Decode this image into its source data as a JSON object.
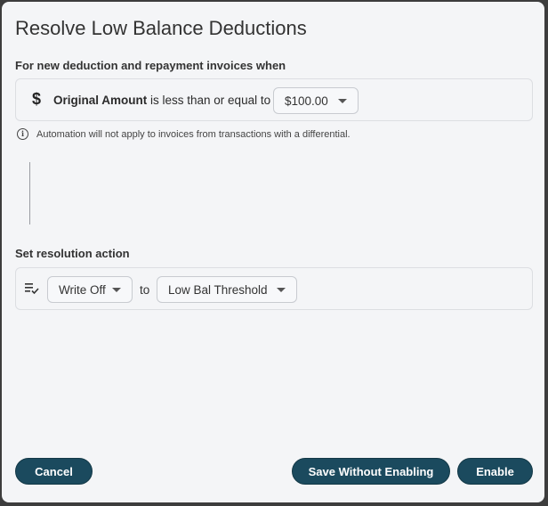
{
  "dialog": {
    "title": "Resolve Low Balance Deductions"
  },
  "condition": {
    "section_label": "For new deduction and repayment invoices when",
    "icon": "dollar-icon",
    "field": "Original Amount",
    "operator_text": "is less than or equal to",
    "amount": "$100.00"
  },
  "info": {
    "icon": "info-icon",
    "text": "Automation will not apply to invoices from transactions with a differential."
  },
  "action": {
    "section_label": "Set resolution action",
    "icon": "list-check-icon",
    "action_value": "Write Off",
    "connector": "to",
    "target_value": "Low Bal Threshold"
  },
  "footer": {
    "cancel_label": "Cancel",
    "save_label": "Save Without Enabling",
    "enable_label": "Enable"
  },
  "colors": {
    "primary_button": "#1b4a5e",
    "background": "#f4f5f7",
    "backdrop": "#3d3d3d"
  }
}
